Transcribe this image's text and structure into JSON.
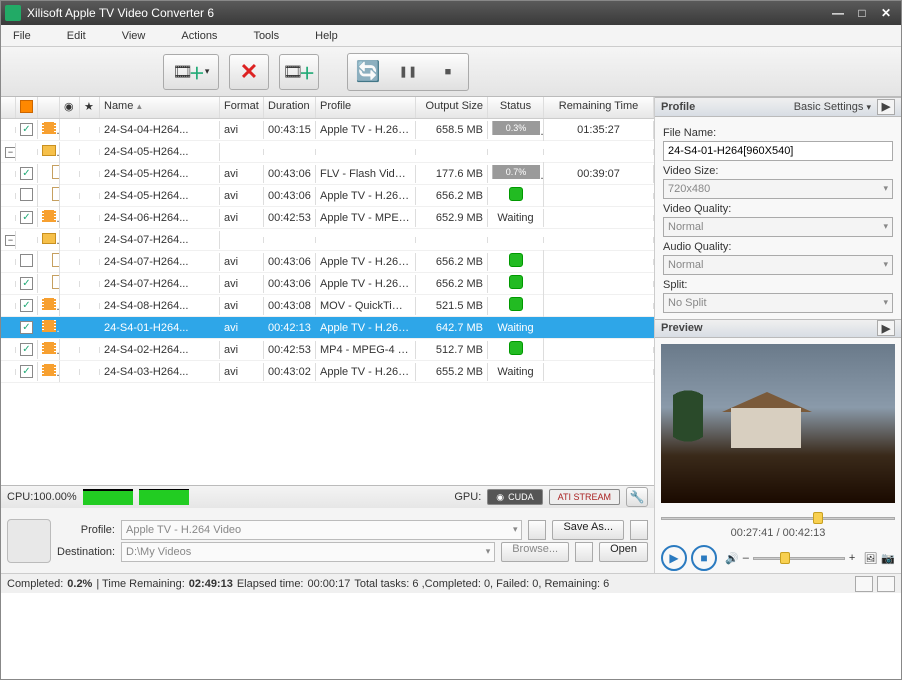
{
  "window": {
    "title": "Xilisoft Apple TV Video Converter 6"
  },
  "menu": {
    "file": "File",
    "edit": "Edit",
    "view": "View",
    "actions": "Actions",
    "tools": "Tools",
    "help": "Help"
  },
  "columns": {
    "name": "Name",
    "format": "Format",
    "duration": "Duration",
    "profile": "Profile",
    "output": "Output Size",
    "status": "Status",
    "remaining": "Remaining Time"
  },
  "rows": [
    {
      "type": "file",
      "indent": 0,
      "checked": true,
      "icon": "film",
      "name": "24-S4-04-H264...",
      "fmt": "avi",
      "dur": "00:43:15",
      "prof": "Apple TV - H.264 ...",
      "out": "658.5 MB",
      "status": "progress",
      "pct": "0.3%",
      "rem": "01:35:27"
    },
    {
      "type": "group",
      "indent": 0,
      "exp": "minus",
      "icon": "folder",
      "name": "24-S4-05-H264..."
    },
    {
      "type": "file",
      "indent": 1,
      "checked": true,
      "icon": "doc",
      "name": "24-S4-05-H264...",
      "fmt": "avi",
      "dur": "00:43:06",
      "prof": "FLV - Flash Video ...",
      "out": "177.6 MB",
      "status": "progress",
      "pct": "0.7%",
      "rem": "00:39:07"
    },
    {
      "type": "file",
      "indent": 1,
      "checked": false,
      "icon": "doc",
      "name": "24-S4-05-H264...",
      "fmt": "avi",
      "dur": "00:43:06",
      "prof": "Apple TV - H.264 ...",
      "out": "656.2 MB",
      "status": "ready"
    },
    {
      "type": "file",
      "indent": 0,
      "checked": true,
      "icon": "film",
      "name": "24-S4-06-H264...",
      "fmt": "avi",
      "dur": "00:42:53",
      "prof": "Apple TV - MPEG...",
      "out": "652.9 MB",
      "status": "waiting"
    },
    {
      "type": "group",
      "indent": 0,
      "exp": "minus",
      "icon": "folder",
      "name": "24-S4-07-H264..."
    },
    {
      "type": "file",
      "indent": 1,
      "checked": false,
      "icon": "doc",
      "name": "24-S4-07-H264...",
      "fmt": "avi",
      "dur": "00:43:06",
      "prof": "Apple TV - H.264 ...",
      "out": "656.2 MB",
      "status": "ready"
    },
    {
      "type": "file",
      "indent": 1,
      "checked": true,
      "icon": "doc",
      "name": "24-S4-07-H264...",
      "fmt": "avi",
      "dur": "00:43:06",
      "prof": "Apple TV - H.264 ...",
      "out": "656.2 MB",
      "status": "ready"
    },
    {
      "type": "file",
      "indent": 0,
      "checked": true,
      "icon": "film",
      "name": "24-S4-08-H264...",
      "fmt": "avi",
      "dur": "00:43:08",
      "prof": "MOV - QuickTime ...",
      "out": "521.5 MB",
      "status": "ready"
    },
    {
      "type": "file",
      "indent": 0,
      "checked": true,
      "icon": "film",
      "name": "24-S4-01-H264...",
      "fmt": "avi",
      "dur": "00:42:13",
      "prof": "Apple TV - H.264 ...",
      "out": "642.7 MB",
      "status": "waiting",
      "selected": true
    },
    {
      "type": "file",
      "indent": 0,
      "checked": true,
      "icon": "film",
      "name": "24-S4-02-H264...",
      "fmt": "avi",
      "dur": "00:42:53",
      "prof": "MP4 - MPEG-4 Vid...",
      "out": "512.7 MB",
      "status": "ready"
    },
    {
      "type": "file",
      "indent": 0,
      "checked": true,
      "icon": "film",
      "name": "24-S4-03-H264...",
      "fmt": "avi",
      "dur": "00:43:02",
      "prof": "Apple TV - H.264 ...",
      "out": "655.2 MB",
      "status": "waiting"
    }
  ],
  "waiting_label": "Waiting",
  "profile_panel": {
    "header": "Profile",
    "settings": "Basic Settings",
    "filename_label": "File Name:",
    "filename": "24-S4-01-H264[960X540]",
    "videosize_label": "Video Size:",
    "videosize": "720x480",
    "videoquality_label": "Video Quality:",
    "videoquality": "Normal",
    "audioquality_label": "Audio Quality:",
    "audioquality": "Normal",
    "split_label": "Split:",
    "split": "No Split"
  },
  "preview": {
    "header": "Preview",
    "time": "00:27:41 / 00:42:13",
    "pos_pct": 65
  },
  "gpu": {
    "cpu_label": "CPU:100.00%",
    "gpu_label": "GPU:",
    "cuda": "CUDA",
    "ati": "ATI STREAM"
  },
  "dest": {
    "profile_label": "Profile:",
    "profile_value": "Apple TV - H.264 Video",
    "saveas": "Save As...",
    "dest_label": "Destination:",
    "dest_value": "D:\\My Videos",
    "browse": "Browse...",
    "open": "Open"
  },
  "status": {
    "completed_label": "Completed: ",
    "completed": "0.2%",
    "time_rem_label": " | Time Remaining: ",
    "time_rem": "02:49:13",
    "elapsed_label": " Elapsed time: ",
    "elapsed": "00:00:17",
    "tasks": " Total tasks: 6 ,Completed: 0, Failed: 0, Remaining: 6"
  }
}
